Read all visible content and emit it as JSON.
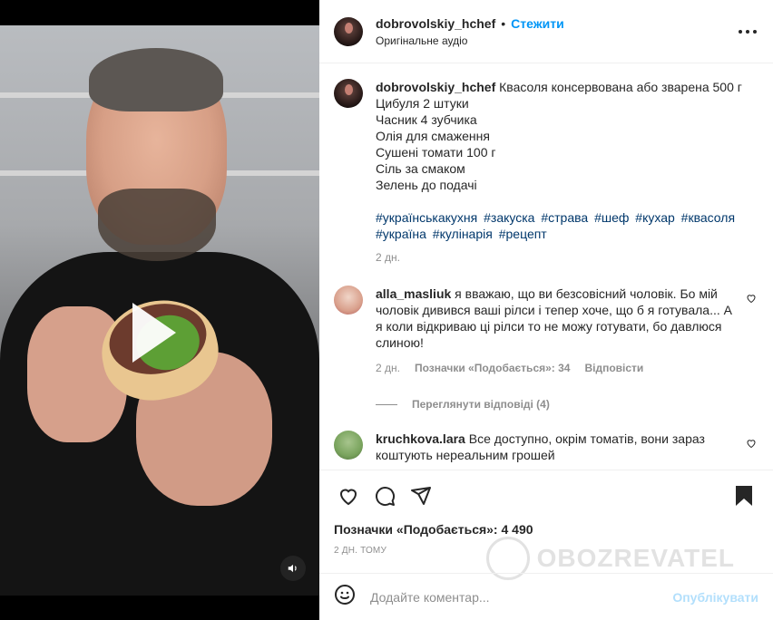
{
  "post": {
    "username": "dobrovolskiy_hchef",
    "follow_label": "Стежити",
    "audio": "Оригінальне аудіо"
  },
  "caption": {
    "username": "dobrovolskiy_hchef",
    "lines": [
      "Квасоля консервована або зварена 500 г",
      "Цибуля 2 штуки",
      "Часник 4 зубчика",
      "Олія для смаження",
      "Сушені томати 100 г",
      "Сіль за смаком",
      "Зелень до подачі"
    ],
    "hashtags": [
      "#українськакухня",
      "#закуска",
      "#страва",
      "#шеф",
      "#кухар",
      "#квасоля",
      "#україна",
      "#кулінарія",
      "#рецепт"
    ],
    "time": "2 дн."
  },
  "comments": [
    {
      "username": "alla_masliuk",
      "text": "я вважаю, що ви безсовісний чоловік. Бо мій чоловік дивився ваші рілси і тепер хоче, що б я готувала... А я коли відкриваю ці рілси то не можу готувати, бо давлюся слиною!",
      "time": "2 дн.",
      "likes": "Позначки «Подобається»: 34",
      "reply": "Відповісти",
      "view_replies": "Переглянути відповіді (4)"
    },
    {
      "username": "kruchkova.lara",
      "text": "Все доступно, окрім томатів, вони зараз коштують нереальним грошей"
    }
  ],
  "icons": {
    "heart": "heart-icon",
    "comment": "comment-icon",
    "share": "share-icon",
    "save": "bookmark-icon",
    "more": "more-icon",
    "emoji": "emoji-icon",
    "mute": "speaker-icon"
  },
  "likes_label": "Позначки «Подобається»: 4 490",
  "post_time": "2 дн. тому",
  "add_comment": {
    "placeholder": "Додайте коментар...",
    "publish_label": "Опублікувати"
  },
  "watermark": "OBOZREVATEL",
  "colors": {
    "follow": "#0095f6",
    "hashtag": "#00376b",
    "publish_disabled": "#b2dffc"
  }
}
